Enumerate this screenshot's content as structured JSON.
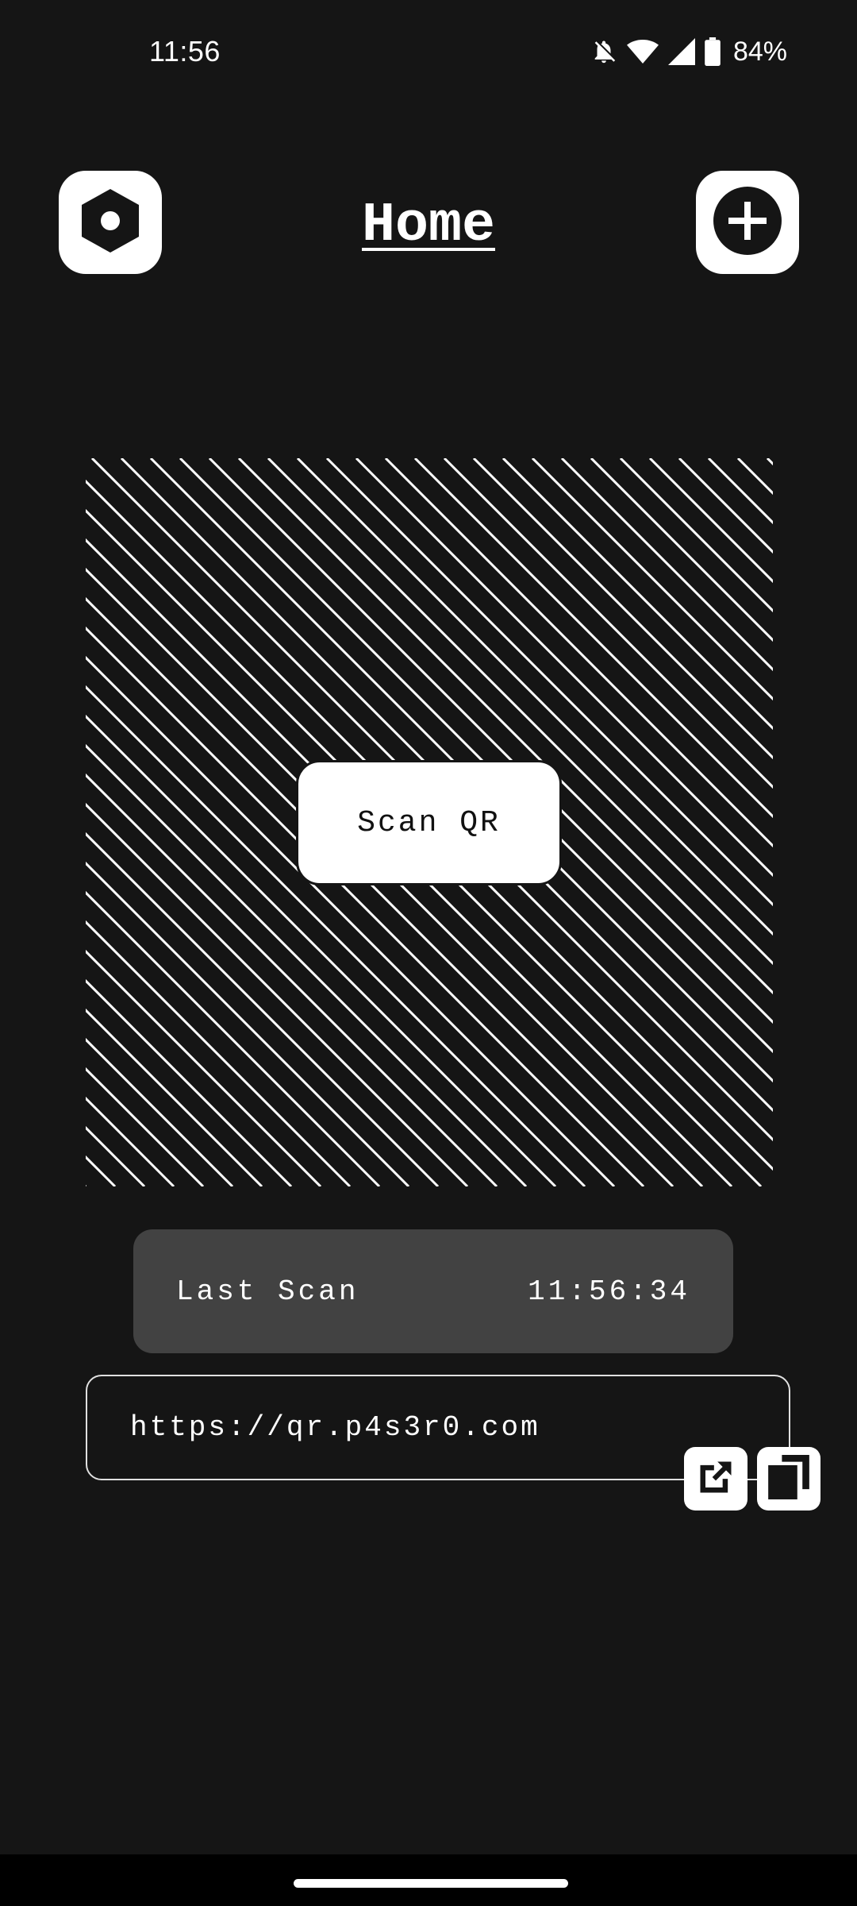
{
  "status_bar": {
    "time": "11:56",
    "battery": "84%",
    "icons": [
      "bell-off-icon",
      "wifi-icon",
      "cell-signal-icon",
      "battery-icon"
    ]
  },
  "header": {
    "title": "Home",
    "left_icon": "settings-hexagon-icon",
    "right_icon": "add-circle-icon"
  },
  "scanner": {
    "button_label": "Scan QR"
  },
  "last_scan": {
    "label": "Last Scan",
    "time": "11:56:34"
  },
  "result": {
    "url": "https://qr.p4s3r0.com",
    "open_icon": "open-external-icon",
    "copy_icon": "copy-icon"
  },
  "colors": {
    "background": "#151515",
    "surface": "#424242",
    "foreground": "#ffffff"
  }
}
